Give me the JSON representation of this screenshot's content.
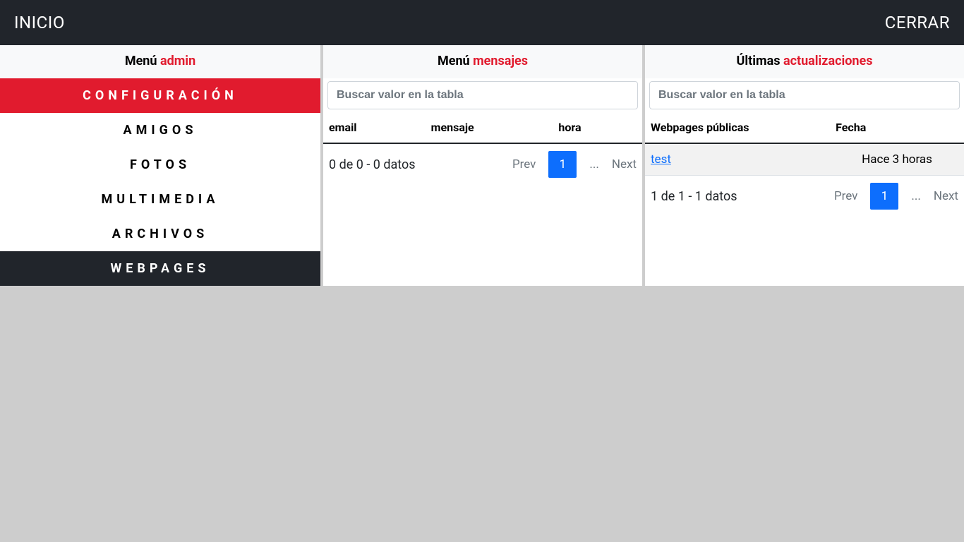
{
  "topbar": {
    "home": "INICIO",
    "logout": "CERRAR"
  },
  "sidebar": {
    "title_prefix": "Menú ",
    "title_accent": "admin",
    "items": [
      {
        "label": "CONFIGURACIÓN",
        "state": "active"
      },
      {
        "label": "AMIGOS",
        "state": ""
      },
      {
        "label": "FOTOS",
        "state": ""
      },
      {
        "label": "MULTIMEDIA",
        "state": ""
      },
      {
        "label": "ARCHIVOS",
        "state": ""
      },
      {
        "label": "WEBPAGES",
        "state": "dark"
      }
    ]
  },
  "messages": {
    "title_prefix": "Menú ",
    "title_accent": "mensajes",
    "search_placeholder": "Buscar valor en la tabla",
    "columns": {
      "c0": "email",
      "c1": "mensaje",
      "c2": "hora"
    },
    "count_text": "0 de 0 - 0 datos",
    "pager": {
      "prev": "Prev",
      "page": "1",
      "dots": "...",
      "next": "Next"
    }
  },
  "updates": {
    "title_prefix": "Últimas ",
    "title_accent": "actualizaciones",
    "search_placeholder": "Buscar valor en la tabla",
    "columns": {
      "c0": "Webpages públicas",
      "c1": "Fecha"
    },
    "rows": [
      {
        "name": "test",
        "date": "Hace 3 horas"
      }
    ],
    "count_text": "1 de 1 - 1 datos",
    "pager": {
      "prev": "Prev",
      "page": "1",
      "dots": "...",
      "next": "Next"
    }
  }
}
